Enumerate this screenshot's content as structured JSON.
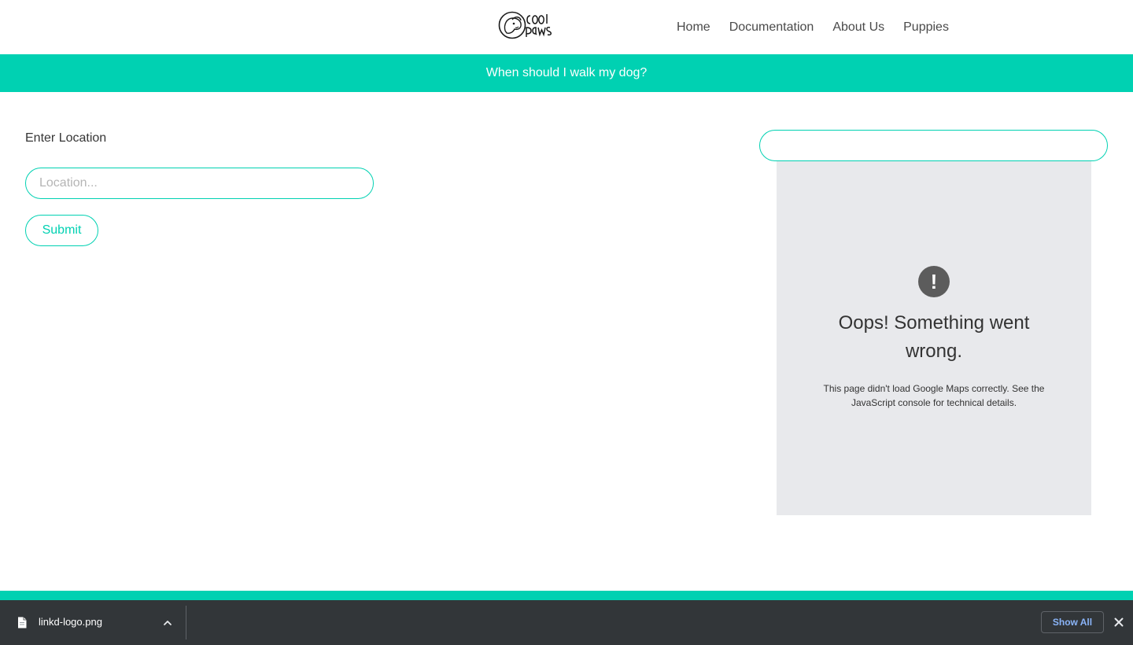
{
  "header": {
    "logo_text": "cool paws",
    "nav": [
      {
        "label": "Home"
      },
      {
        "label": "Documentation"
      },
      {
        "label": "About Us"
      },
      {
        "label": "Puppies"
      }
    ]
  },
  "banner": {
    "text": "When should I walk my dog?"
  },
  "form": {
    "label": "Enter Location",
    "location_placeholder": "Location...",
    "location_value": "",
    "submit_label": "Submit"
  },
  "map": {
    "search_value": "",
    "error_icon_glyph": "!",
    "error_title": "Oops! Something went wrong.",
    "error_text": "This page didn't load Google Maps correctly. See the JavaScript console for technical details."
  },
  "download_bar": {
    "file_name": "linkd-logo.png",
    "show_all_label": "Show All"
  },
  "colors": {
    "accent": "#00d1b2",
    "download_bar_bg": "#323639",
    "map_bg": "#e8e9ec",
    "link_blue": "#8ab4f8"
  }
}
